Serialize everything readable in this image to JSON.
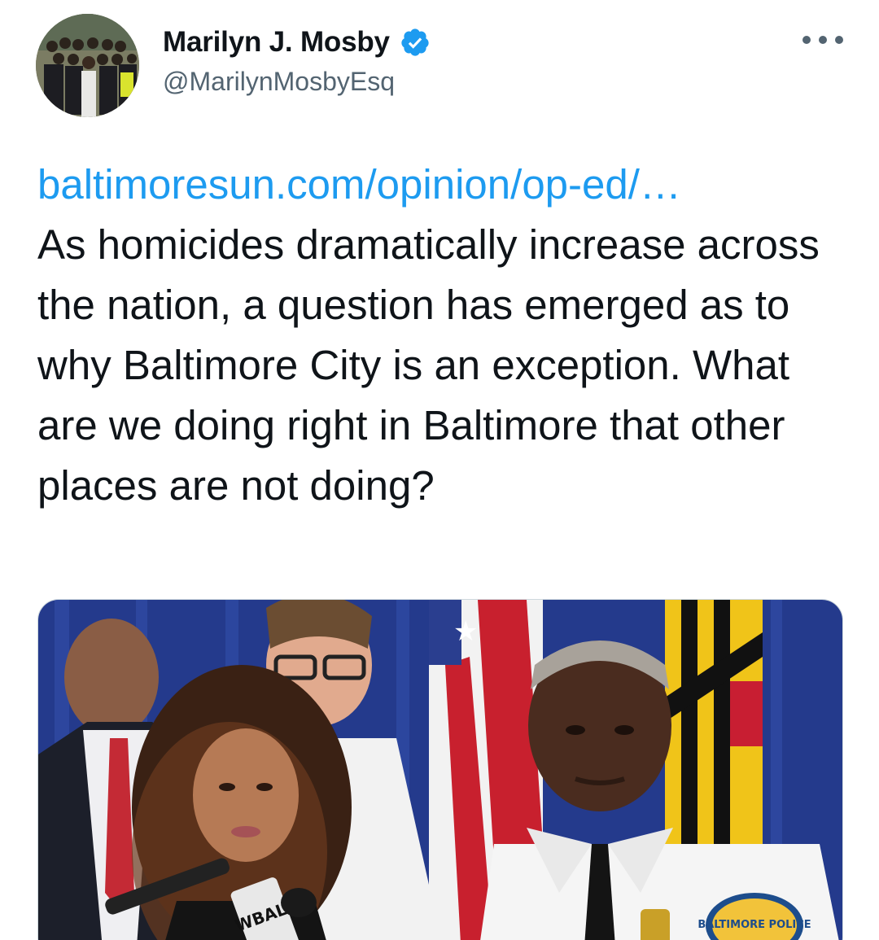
{
  "author": {
    "display_name": "Marilyn J. Mosby",
    "handle": "@MarilynMosbyEsq",
    "verified": true
  },
  "tweet": {
    "link_text": "baltimoresun.com/opinion/op-ed/…",
    "text": "As homicides dramatically increase across the nation, a question has emerged as to why Baltimore City is an exception. What are we doing right in Baltimore that other places are not doing?"
  },
  "media": {
    "mic_label": "WBAL",
    "badge_text": "BALTIMORE POLICE"
  },
  "colors": {
    "link": "#1d9bf0",
    "verified_badge": "#1d9bf0",
    "text": "#0f1419",
    "secondary_text": "#536471"
  },
  "icons": {
    "verified": "verified-badge-icon",
    "more": "more-options-icon"
  }
}
